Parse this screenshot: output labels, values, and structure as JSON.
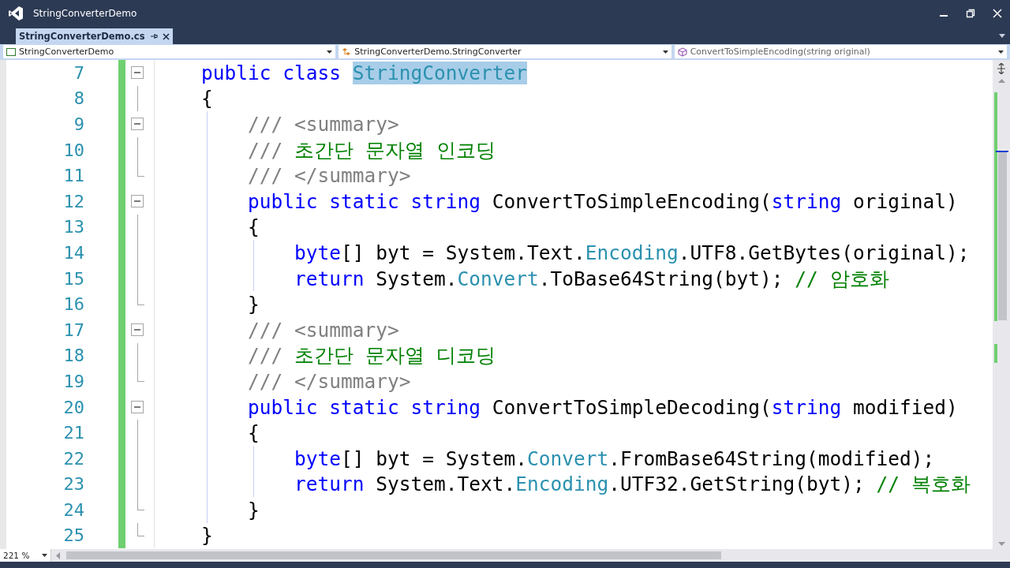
{
  "window": {
    "title": "StringConverterDemo"
  },
  "tabs": [
    {
      "label": "StringConverterDemo.cs",
      "selected": true
    }
  ],
  "navigation": [
    {
      "kind": "project",
      "text": "StringConverterDemo"
    },
    {
      "kind": "class",
      "text": "StringConverterDemo.StringConverter"
    },
    {
      "kind": "method",
      "text": "ConvertToSimpleEncoding(string original)"
    }
  ],
  "editor": {
    "lines": [
      {
        "number": "7",
        "kind": "foldstart",
        "tokens": [
          {
            "kind": "keyword",
            "text": "    public class "
          },
          {
            "kind": "selection",
            "text": "StringConverter"
          }
        ]
      },
      {
        "number": "8",
        "kind": "foldbody",
        "tokens": [
          {
            "kind": "plain",
            "text": "    {"
          }
        ]
      },
      {
        "number": "9",
        "kind": "foldstart",
        "tokens": [
          {
            "kind": "doc",
            "text": "        /// <summary>"
          }
        ]
      },
      {
        "number": "10",
        "kind": "foldbody",
        "tokens": [
          {
            "kind": "doc",
            "text": "        /// "
          },
          {
            "kind": "comment",
            "text": "초간단 문자열 인코딩"
          }
        ]
      },
      {
        "number": "11",
        "kind": "foldend",
        "tokens": [
          {
            "kind": "doc",
            "text": "        /// </summary>"
          }
        ]
      },
      {
        "number": "12",
        "kind": "foldstart",
        "tokens": [
          {
            "kind": "keyword",
            "text": "        public static string "
          },
          {
            "kind": "plain",
            "text": "ConvertToSimpleEncoding("
          },
          {
            "kind": "keyword",
            "text": "string"
          },
          {
            "kind": "plain",
            "text": " original)"
          }
        ]
      },
      {
        "number": "13",
        "kind": "foldbody",
        "tokens": [
          {
            "kind": "plain",
            "text": "        {"
          }
        ]
      },
      {
        "number": "14",
        "kind": "foldbody",
        "tokens": [
          {
            "kind": "keyword",
            "text": "            byte"
          },
          {
            "kind": "plain",
            "text": "[] byt = System.Text."
          },
          {
            "kind": "type",
            "text": "Encoding"
          },
          {
            "kind": "plain",
            "text": ".UTF8.GetBytes(original);"
          }
        ]
      },
      {
        "number": "15",
        "kind": "foldbody",
        "tokens": [
          {
            "kind": "keyword",
            "text": "            return"
          },
          {
            "kind": "plain",
            "text": " System."
          },
          {
            "kind": "type",
            "text": "Convert"
          },
          {
            "kind": "plain",
            "text": ".ToBase64String(byt); "
          },
          {
            "kind": "comment",
            "text": "// 암호화"
          }
        ]
      },
      {
        "number": "16",
        "kind": "foldend",
        "tokens": [
          {
            "kind": "plain",
            "text": "        }"
          }
        ]
      },
      {
        "number": "17",
        "kind": "foldstart",
        "tokens": [
          {
            "kind": "doc",
            "text": "        /// <summary>"
          }
        ]
      },
      {
        "number": "18",
        "kind": "foldbody",
        "tokens": [
          {
            "kind": "doc",
            "text": "        /// "
          },
          {
            "kind": "comment",
            "text": "초간단 문자열 디코딩"
          }
        ]
      },
      {
        "number": "19",
        "kind": "foldend",
        "tokens": [
          {
            "kind": "doc",
            "text": "        /// </summary>"
          }
        ]
      },
      {
        "number": "20",
        "kind": "foldstart",
        "tokens": [
          {
            "kind": "keyword",
            "text": "        public static string "
          },
          {
            "kind": "plain",
            "text": "ConvertToSimpleDecoding("
          },
          {
            "kind": "keyword",
            "text": "string"
          },
          {
            "kind": "plain",
            "text": " modified)"
          }
        ]
      },
      {
        "number": "21",
        "kind": "foldbody",
        "tokens": [
          {
            "kind": "plain",
            "text": "        {"
          }
        ]
      },
      {
        "number": "22",
        "kind": "foldbody",
        "tokens": [
          {
            "kind": "keyword",
            "text": "            byte"
          },
          {
            "kind": "plain",
            "text": "[] byt = System."
          },
          {
            "kind": "type",
            "text": "Convert"
          },
          {
            "kind": "plain",
            "text": ".FromBase64String(modified);"
          }
        ]
      },
      {
        "number": "23",
        "kind": "foldbody",
        "tokens": [
          {
            "kind": "keyword",
            "text": "            return"
          },
          {
            "kind": "plain",
            "text": " System.Text."
          },
          {
            "kind": "type",
            "text": "Encoding"
          },
          {
            "kind": "plain",
            "text": ".UTF32.GetString(byt); "
          },
          {
            "kind": "comment",
            "text": "// 복호화"
          }
        ]
      },
      {
        "number": "24",
        "kind": "foldend",
        "tokens": [
          {
            "kind": "plain",
            "text": "        }"
          }
        ]
      },
      {
        "number": "25",
        "kind": "foldend",
        "tokens": [
          {
            "kind": "plain",
            "text": "    }"
          }
        ]
      }
    ]
  },
  "status_bar": {
    "zoom": "221 %"
  }
}
